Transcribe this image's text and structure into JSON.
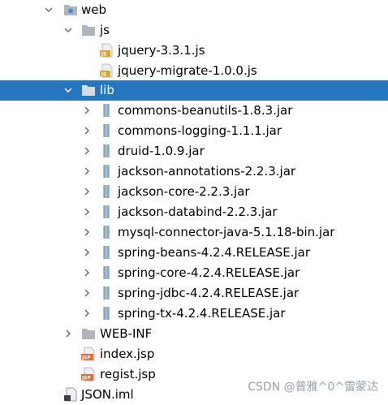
{
  "tree": {
    "web": "web",
    "js": "js",
    "js_files": [
      "jquery-3.3.1.js",
      "jquery-migrate-1.0.0.js"
    ],
    "lib": "lib",
    "jars": [
      "commons-beanutils-1.8.3.jar",
      "commons-logging-1.1.1.jar",
      "druid-1.0.9.jar",
      "jackson-annotations-2.2.3.jar",
      "jackson-core-2.2.3.jar",
      "jackson-databind-2.2.3.jar",
      "mysql-connector-java-5.1.18-bin.jar",
      "spring-beans-4.2.4.RELEASE.jar",
      "spring-core-4.2.4.RELEASE.jar",
      "spring-jdbc-4.2.4.RELEASE.jar",
      "spring-tx-4.2.4.RELEASE.jar"
    ],
    "web_inf": "WEB-INF",
    "jsp_files": [
      "index.jsp",
      "regist.jsp"
    ],
    "iml_file": "JSON.iml"
  },
  "icons": {
    "expanded": "chevron-down-icon",
    "collapsed": "chevron-right-icon",
    "folder": "folder-icon",
    "web_folder": "web-folder-icon",
    "js_file": "js-file-icon",
    "jar_file": "jar-library-icon",
    "jsp_file": "jsp-file-icon",
    "iml_file": "iml-file-icon"
  },
  "colors": {
    "selection": "#2675bf",
    "folder": "#b1b5bb",
    "js": "#e3a528",
    "jsp": "#e06c3a",
    "jar": "#a7c4d8"
  },
  "watermark": "CSDN @普雅^0^雷蒙达"
}
